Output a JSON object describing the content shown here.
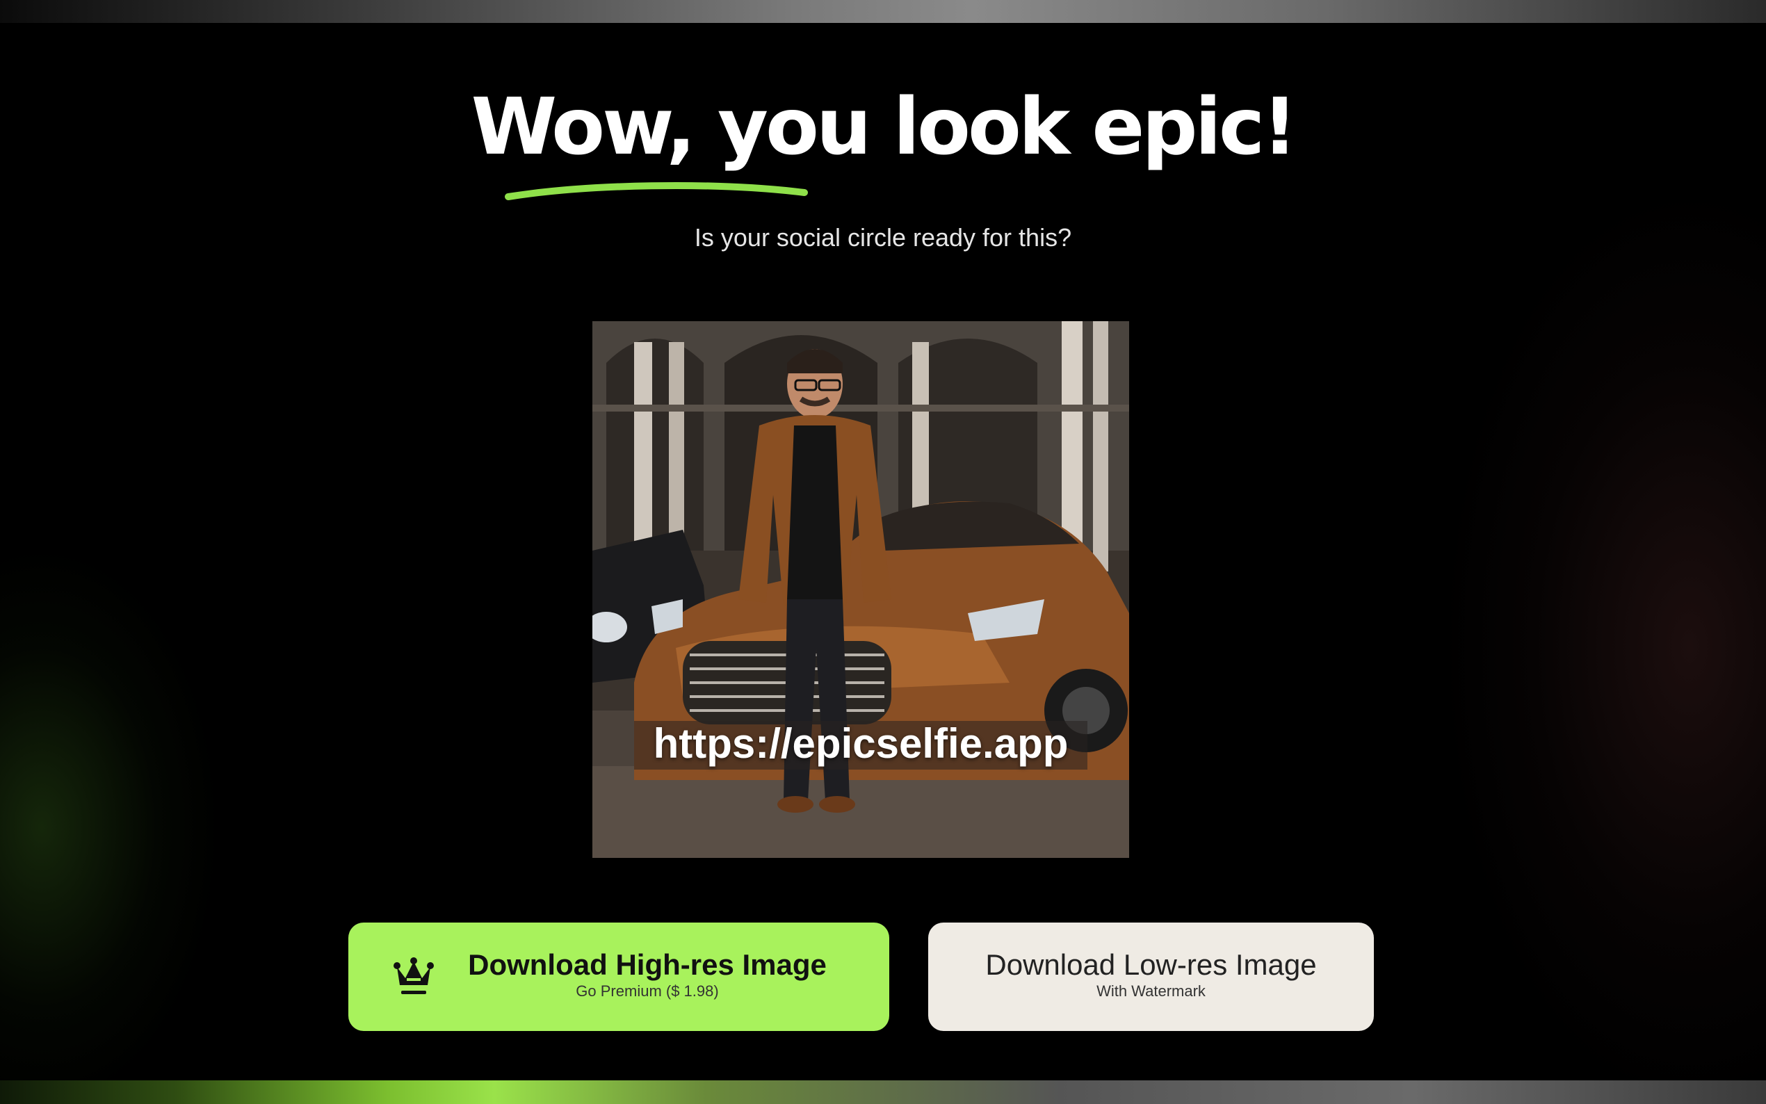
{
  "headline": "Wow, you look epic!",
  "subtitle": "Is your social circle ready for this?",
  "preview": {
    "watermark_text": "https://epicselfie.app"
  },
  "buttons": {
    "high_res": {
      "title": "Download High-res Image",
      "subtitle": "Go Premium ($ 1.98)",
      "icon": "crown-icon"
    },
    "low_res": {
      "title": "Download Low-res Image",
      "subtitle": "With Watermark"
    }
  },
  "colors": {
    "accent_green": "#a8f25c",
    "secondary_button": "#efebe4",
    "background": "#000000"
  }
}
